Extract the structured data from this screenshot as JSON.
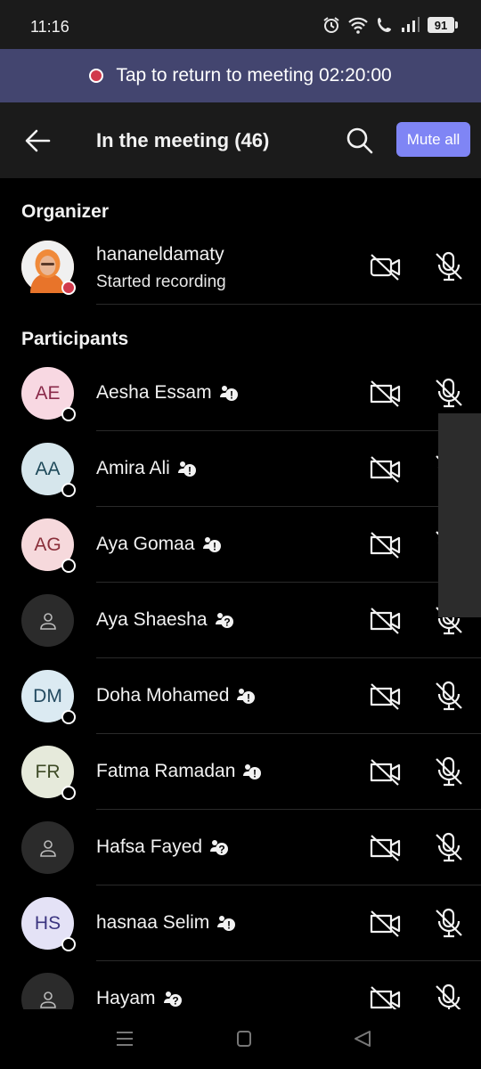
{
  "status_bar": {
    "time": "11:16",
    "battery": "91"
  },
  "banner": {
    "text": "Tap to return to meeting 02:20:00"
  },
  "header": {
    "title": "In the meeting (46)",
    "mute_all_label": "Mute all"
  },
  "organizer_section": {
    "title": "Organizer",
    "person": {
      "name": "hananeldamaty",
      "status": "Started recording"
    }
  },
  "participants_section": {
    "title": "Participants",
    "people": [
      {
        "initials": "AE",
        "name": "Aesha Essam",
        "badge": "!",
        "avatar_bg": "#f8d8e2",
        "avatar_fg": "#8a2a4a",
        "presence": true
      },
      {
        "initials": "AA",
        "name": "Amira Ali",
        "badge": "!",
        "avatar_bg": "#d6e6ec",
        "avatar_fg": "#1f4a5a",
        "presence": true
      },
      {
        "initials": "AG",
        "name": "Aya Gomaa",
        "badge": "!",
        "avatar_bg": "#f6d9dc",
        "avatar_fg": "#8a2f3a",
        "presence": true
      },
      {
        "initials": "",
        "name": "Aya Shaesha",
        "badge": "?",
        "avatar_bg": "#2b2b2b",
        "avatar_fg": "#bbbbbb",
        "presence": false
      },
      {
        "initials": "DM",
        "name": "Doha Mohamed",
        "badge": "!",
        "avatar_bg": "#dbeaf2",
        "avatar_fg": "#234a60",
        "presence": true
      },
      {
        "initials": "FR",
        "name": "Fatma Ramadan",
        "badge": "!",
        "avatar_bg": "#e6eadb",
        "avatar_fg": "#3d4a25",
        "presence": true
      },
      {
        "initials": "",
        "name": "Hafsa Fayed",
        "badge": "?",
        "avatar_bg": "#2b2b2b",
        "avatar_fg": "#bbbbbb",
        "presence": false
      },
      {
        "initials": "HS",
        "name": "hasnaa Selim",
        "badge": "!",
        "avatar_bg": "#e4e2f6",
        "avatar_fg": "#3b3580",
        "presence": true
      },
      {
        "initials": "",
        "name": "Hayam",
        "badge": "?",
        "avatar_bg": "#2b2b2b",
        "avatar_fg": "#bbbbbb",
        "presence": false
      }
    ]
  },
  "colors": {
    "accent": "#7f85f5",
    "banner": "#43456f",
    "recording": "#d13a4c"
  }
}
